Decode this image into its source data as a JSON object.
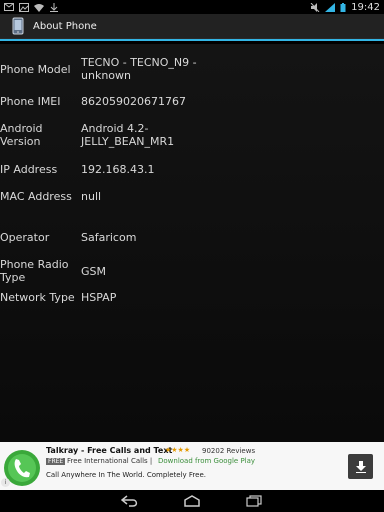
{
  "status": {
    "time": "19:42",
    "left_icons": [
      "mail-icon",
      "image-icon",
      "wifi-icon",
      "download-icon"
    ],
    "right_icons": [
      "mute-icon",
      "signal-icon",
      "battery-icon"
    ]
  },
  "actionbar": {
    "title": "About Phone",
    "icon": "phone-icon"
  },
  "rows": [
    {
      "label": "Phone Model",
      "value": "TECNO - TECNO_N9 - unknown"
    },
    {
      "label": "Phone IMEI",
      "value": "862059020671767"
    },
    {
      "label": "Android Version",
      "value": "Android 4.2-JELLY_BEAN_MR1"
    },
    {
      "label": "IP Address",
      "value": "192.168.43.1"
    },
    {
      "label": "MAC Address",
      "value": "null"
    },
    {
      "label": "Operator",
      "value": "Safaricom"
    },
    {
      "label": "Phone Radio Type",
      "value": "GSM"
    },
    {
      "label": "Network Type",
      "value": "HSPAP"
    }
  ],
  "ad": {
    "title": "Talkray - Free Calls and Text",
    "stars": "★★★★",
    "reviews": "90202 Reviews",
    "free_badge": "FREE",
    "line2": "Free International Calls |",
    "google_play": "Download from Google Play",
    "line3": "Call Anywhere In The World. Completely Free.",
    "icon": "talkray-icon",
    "download_icon": "download-arrow-icon",
    "info_icon": "info-icon"
  },
  "nav": [
    "back-icon",
    "home-icon",
    "recents-icon"
  ],
  "colors": {
    "accent": "#33b5e5",
    "actionbar": "#222222",
    "background": "#000000"
  }
}
